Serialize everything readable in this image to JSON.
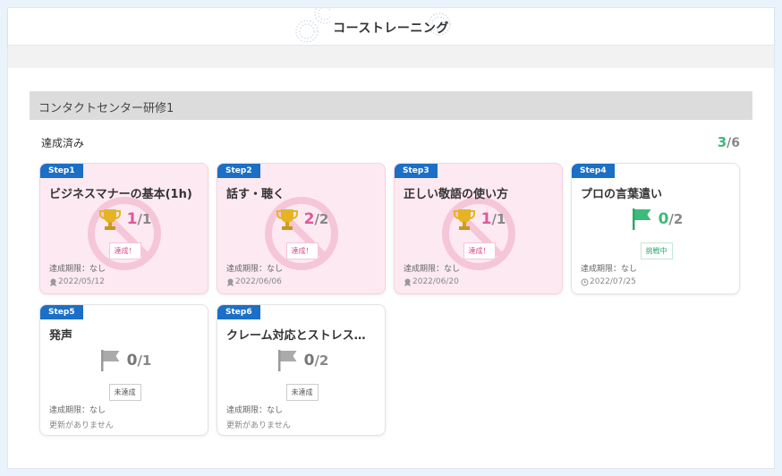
{
  "header": {
    "title": "コーストレーニング"
  },
  "section": {
    "title": "コンタクトセンター研修1"
  },
  "status": {
    "label": "達成済み",
    "done": "3",
    "total": "/6"
  },
  "colors": {
    "step_badge": "#1b6fc7",
    "achieved_bg": "#fde9f1",
    "pink": "#e0579b",
    "green": "#3cba7a"
  },
  "cards": [
    {
      "step": "Step1",
      "title": "ビジネスマナーの基本(1h)",
      "count": "1",
      "total": "/1",
      "tag": "達成！",
      "deadline": "達成期限：なし",
      "date": "2022/05/12",
      "icon": "trophy-icon",
      "date_icon": "medal-icon"
    },
    {
      "step": "Step2",
      "title": "話す・聴く",
      "count": "2",
      "total": "/2",
      "tag": "達成！",
      "deadline": "達成期限：なし",
      "date": "2022/06/06",
      "icon": "trophy-icon",
      "date_icon": "medal-icon"
    },
    {
      "step": "Step3",
      "title": "正しい敬語の使い方",
      "count": "1",
      "total": "/1",
      "tag": "達成！",
      "deadline": "達成期限：なし",
      "date": "2022/06/20",
      "icon": "trophy-icon",
      "date_icon": "medal-icon"
    },
    {
      "step": "Step4",
      "title": "プロの言葉遣い",
      "count": "0",
      "total": "/2",
      "tag": "挑戦中",
      "deadline": "達成期限：なし",
      "date": "2022/07/25",
      "icon": "green-flag-icon",
      "date_icon": "clock-icon"
    },
    {
      "step": "Step5",
      "title": "発声",
      "count": "0",
      "total": "/1",
      "tag": "未達成",
      "deadline": "達成期限：なし",
      "date": "更新がありません",
      "icon": "gray-flag-icon"
    },
    {
      "step": "Step6",
      "title": "クレーム対応とストレス…",
      "count": "0",
      "total": "/2",
      "tag": "未達成",
      "deadline": "達成期限：なし",
      "date": "更新がありません",
      "icon": "gray-flag-icon"
    }
  ]
}
